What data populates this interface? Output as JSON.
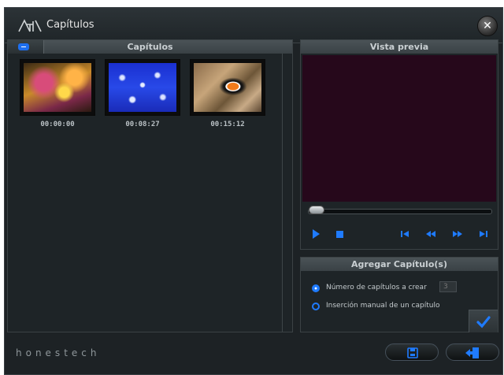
{
  "window": {
    "title": "Capítulos"
  },
  "chapters_panel": {
    "header": "Capítulos",
    "items": [
      {
        "time": "00:00:00"
      },
      {
        "time": "00:08:27"
      },
      {
        "time": "00:15:12"
      }
    ]
  },
  "preview_panel": {
    "header": "Vista previa"
  },
  "add_panel": {
    "header": "Agregar Capítulo(s)",
    "option_count_label": "Número de capítulos a crear",
    "option_count_value": "3",
    "option_manual_label": "Inserción manual de un capítulo"
  },
  "footer": {
    "brand": "honestech"
  },
  "colors": {
    "accent": "#1f7bff",
    "preview_bg": "#26081b",
    "window_bg": "#1d2225"
  }
}
